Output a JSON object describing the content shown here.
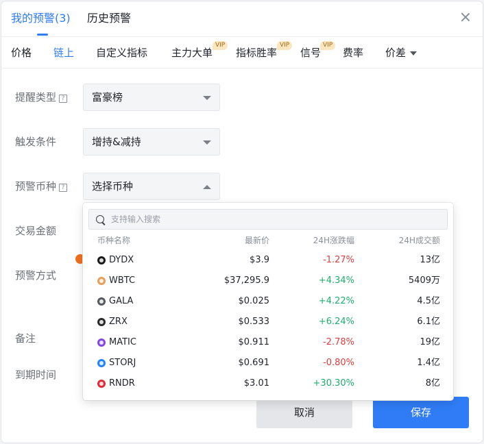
{
  "header": {
    "tabs": [
      {
        "label": "我的预警(3)",
        "active": true
      },
      {
        "label": "历史预警",
        "active": false
      }
    ]
  },
  "sub_tabs": [
    {
      "label": "价格",
      "active": false,
      "vip": false
    },
    {
      "label": "链上",
      "active": true,
      "vip": false
    },
    {
      "label": "自定义指标",
      "active": false,
      "vip": false
    },
    {
      "label": "主力大单",
      "active": false,
      "vip": true
    },
    {
      "label": "指标胜率",
      "active": false,
      "vip": true
    },
    {
      "label": "信号",
      "active": false,
      "vip": true
    },
    {
      "label": "费率",
      "active": false,
      "vip": false
    },
    {
      "label": "价差",
      "active": false,
      "vip": false
    }
  ],
  "vip_label": "VIP",
  "form": {
    "alert_type": {
      "label": "提醒类型",
      "value": "富豪榜"
    },
    "trigger": {
      "label": "触发条件",
      "value": "增持&减持"
    },
    "coin": {
      "label": "预警币种",
      "value": "选择币种"
    },
    "amount": {
      "label": "交易金额"
    },
    "method": {
      "label": "预警方式"
    },
    "note": {
      "label": "备注"
    },
    "expire": {
      "label": "到期时间"
    }
  },
  "help_glyph": "?",
  "dropdown": {
    "search_placeholder": "支持输入搜索",
    "columns": {
      "name": "币种名称",
      "price": "最新价",
      "change": "24H涨跌幅",
      "volume": "24H成交额"
    },
    "rows": [
      {
        "name": "DYDX",
        "price": "$3.9",
        "change": "-1.27%",
        "direction": "down",
        "volume": "13亿",
        "color": "#1a1a1a"
      },
      {
        "name": "WBTC",
        "price": "$37,295.9",
        "change": "+4.34%",
        "direction": "up",
        "volume": "5409万",
        "color": "#e7a05a"
      },
      {
        "name": "GALA",
        "price": "$0.025",
        "change": "+4.22%",
        "direction": "up",
        "volume": "4.5亿",
        "color": "#555a60"
      },
      {
        "name": "ZRX",
        "price": "$0.533",
        "change": "+6.24%",
        "direction": "up",
        "volume": "6.1亿",
        "color": "#2b2b2b"
      },
      {
        "name": "MATIC",
        "price": "$0.911",
        "change": "-2.78%",
        "direction": "down",
        "volume": "19亿",
        "color": "#8247e5"
      },
      {
        "name": "STORJ",
        "price": "$0.691",
        "change": "-0.80%",
        "direction": "down",
        "volume": "1.4亿",
        "color": "#2683ff"
      },
      {
        "name": "RNDR",
        "price": "$3.01",
        "change": "+30.30%",
        "direction": "up",
        "volume": "8亿",
        "color": "#e12d35"
      }
    ]
  },
  "footer": {
    "cancel": "取消",
    "save": "保存"
  }
}
